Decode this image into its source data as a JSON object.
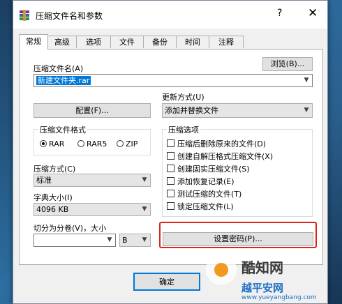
{
  "window": {
    "title": "压缩文件名和参数",
    "help": "?",
    "close": "✕"
  },
  "tabs": [
    "常规",
    "高级",
    "选项",
    "文件",
    "备份",
    "时间",
    "注释"
  ],
  "archive_name": {
    "label": "压缩文件名(A)",
    "value": "新建文件夹.rar",
    "browse": "浏览(B)..."
  },
  "update_mode": {
    "label": "更新方式(U)",
    "value": "添加并替换文件"
  },
  "profile_button": "配置(F)...",
  "format": {
    "label": "压缩文件格式",
    "options": [
      "RAR",
      "RAR5",
      "ZIP"
    ],
    "selected": "RAR"
  },
  "method": {
    "label": "压缩方式(C)",
    "value": "标准"
  },
  "dict": {
    "label": "字典大小(I)",
    "value": "4096 KB"
  },
  "split": {
    "label": "切分为分卷(V)，大小",
    "value": "",
    "unit": "B"
  },
  "options": {
    "label": "压缩选项",
    "items": [
      "压缩后删除原来的文件(D)",
      "创建自解压格式压缩文件(X)",
      "创建固实压缩文件(S)",
      "添加恢复记录(E)",
      "测试压缩的文件(T)",
      "锁定压缩文件(L)"
    ]
  },
  "password_button": "设置密码(P)...",
  "ok_button": "确定",
  "watermark": {
    "brand": "酷知网",
    "sub": "越平安网",
    "url": "www.yueyangbang.com"
  },
  "colors": {
    "highlight": "#d9261c",
    "selection": "#0078d7"
  }
}
